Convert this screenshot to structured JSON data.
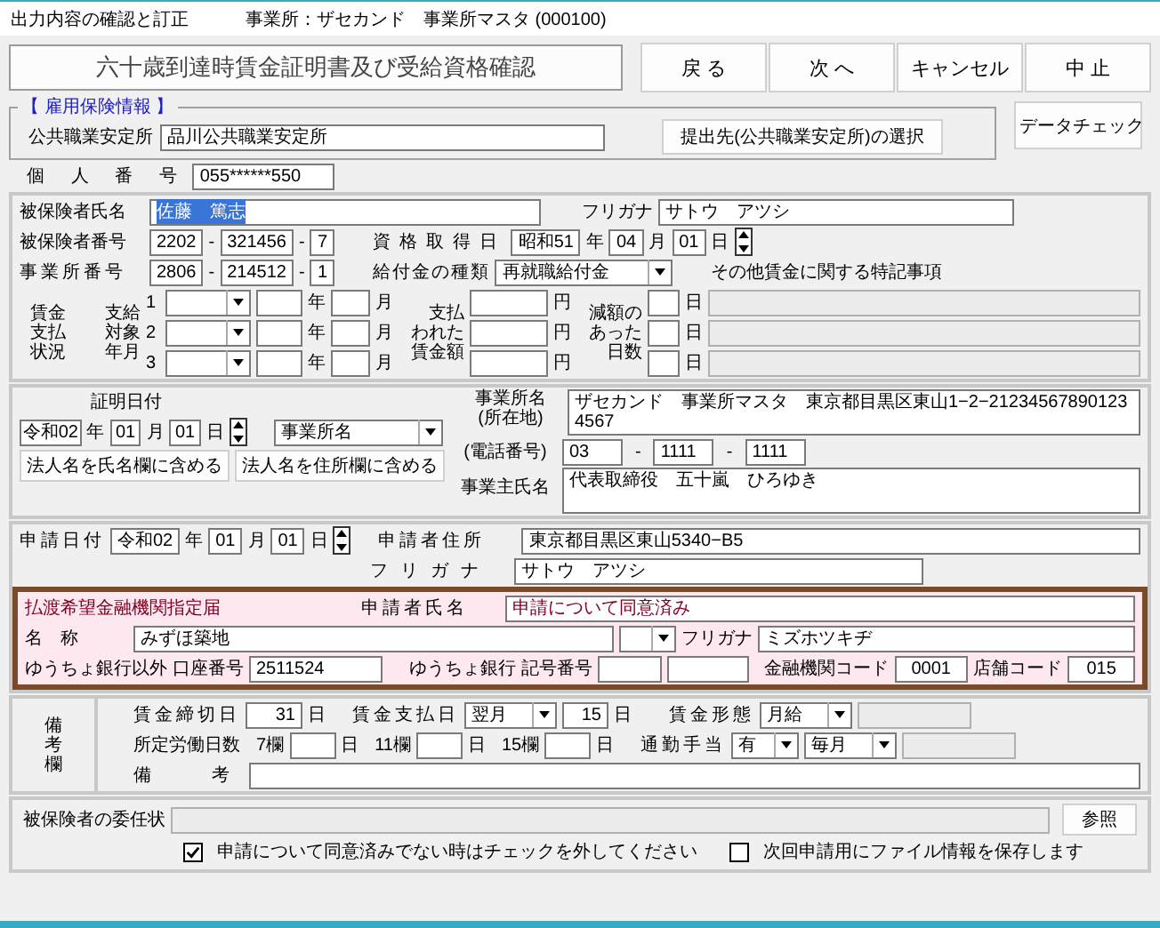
{
  "header": {
    "title": "出力内容の確認と訂正",
    "office": "事業所：ザセカンド　事業所マスタ (000100)"
  },
  "form_title": "六十歳到達時賃金証明書及び受給資格確認",
  "nav_buttons": [
    "戻 る",
    "次 へ",
    "キャンセル",
    "中 止"
  ],
  "insurance": {
    "legend": "【 雇用保険情報 】",
    "office_label": "公共職業安定所",
    "office_value": "品川公共職業安定所",
    "select_button": "提出先(公共職業安定所)の選択"
  },
  "data_check_button": "データチェック",
  "personal_number": {
    "label": "個 人 番 号",
    "value": "055******550"
  },
  "insured": {
    "name_label": "被保険者氏名",
    "name_value": "佐藤　篤志",
    "name_selected": true,
    "kana_label": "フリガナ",
    "kana_value": "サトウ　アツシ",
    "number_label": "被保険者番号",
    "number": [
      {
        "kind": "field",
        "text": "2202"
      },
      {
        "kind": "sep",
        "text": "-"
      },
      {
        "kind": "field",
        "text": "321456"
      },
      {
        "kind": "sep",
        "text": "-"
      },
      {
        "kind": "field",
        "text": "7"
      }
    ],
    "acq_label": "資格取得日",
    "acq_date": [
      {
        "kind": "field",
        "text": "昭和51"
      },
      {
        "kind": "sep",
        "text": "年"
      },
      {
        "kind": "field",
        "text": "04"
      },
      {
        "kind": "sep",
        "text": "月"
      },
      {
        "kind": "field",
        "text": "01"
      },
      {
        "kind": "sep",
        "text": "日"
      }
    ],
    "office_no_label": "事業所番号",
    "office_no": [
      {
        "kind": "field",
        "text": "2806"
      },
      {
        "kind": "sep",
        "text": "-"
      },
      {
        "kind": "field",
        "text": "214512"
      },
      {
        "kind": "sep",
        "text": "-"
      },
      {
        "kind": "field",
        "text": "1"
      }
    ],
    "benefit_label": "給付金の種類",
    "benefit_value": "再就職給付金",
    "remarks_label": "その他賃金に関する特記事項"
  },
  "wage": {
    "status_label": [
      "賃金",
      "支払",
      "状況"
    ],
    "period_label": [
      "支給",
      "対象",
      "年月"
    ],
    "paid_label": [
      "支払",
      "われた",
      "賃金額"
    ],
    "reduced_label": [
      "減額の",
      "あった",
      "日数"
    ],
    "rows": [
      {
        "no": "1",
        "year_unit": "年",
        "month_unit": "月",
        "yen_unit": "円",
        "day_unit": "日"
      },
      {
        "no": "2",
        "year_unit": "年",
        "month_unit": "月",
        "yen_unit": "円",
        "day_unit": "日"
      },
      {
        "no": "3",
        "year_unit": "年",
        "month_unit": "月",
        "yen_unit": "円",
        "day_unit": "日"
      }
    ]
  },
  "cert": {
    "date_label": "証明日付",
    "date": [
      {
        "kind": "field",
        "text": "令和02"
      },
      {
        "kind": "sep",
        "text": "年"
      },
      {
        "kind": "field",
        "text": "01"
      },
      {
        "kind": "sep",
        "text": "月"
      },
      {
        "kind": "field",
        "text": "01"
      },
      {
        "kind": "sep",
        "text": "日"
      }
    ],
    "office_select": "事業所名",
    "buttons": [
      "法人名を氏名欄に含める",
      "法人名を住所欄に含める"
    ],
    "office_label": "事業所名\n(所在地)",
    "office_value": "ザセカンド　事業所マスタ　東京都目黒区東山1−2−212345678901234567",
    "phone_label": "(電話番号)",
    "phone": [
      {
        "kind": "field",
        "text": "03"
      },
      {
        "kind": "sep",
        "text": "-"
      },
      {
        "kind": "field",
        "text": "1111"
      },
      {
        "kind": "sep",
        "text": "-"
      },
      {
        "kind": "field",
        "text": "1111"
      }
    ],
    "owner_label": "事業主氏名",
    "owner_value": "代表取締役　五十嵐　ひろゆき"
  },
  "application": {
    "date_label": "申請日付",
    "date": [
      {
        "kind": "field",
        "text": "令和02"
      },
      {
        "kind": "sep",
        "text": "年"
      },
      {
        "kind": "field",
        "text": "01"
      },
      {
        "kind": "sep",
        "text": "月"
      },
      {
        "kind": "field",
        "text": "01"
      },
      {
        "kind": "sep",
        "text": "日"
      }
    ],
    "address_label": "申請者住所",
    "address_value": "東京都目黒区東山5340−B5",
    "kana_label": "フリガナ",
    "kana_value": "サトウ　アツシ",
    "name_label": "申請者氏名",
    "name_value": "申請について同意済み"
  },
  "bank": {
    "highlighted": true,
    "title": "払渡希望金融機関指定届",
    "name_label": "名　称",
    "name_value": "みずほ築地",
    "kana_label": "フリガナ",
    "kana_value": "ミズホツキヂ",
    "non_yucho_label": "ゆうちょ銀行以外",
    "account_label": "口座番号",
    "account_value": "2511524",
    "yucho_label": "ゆうちょ銀行",
    "symbol_label": "記号番号",
    "bank_code_label": "金融機関コード",
    "bank_code": "0001",
    "branch_code_label": "店舗コード",
    "branch_code": "015"
  },
  "remarks": {
    "label": "備考欄",
    "closing_label": "賃金締切日",
    "closing_day": "31",
    "closing_unit": "日",
    "pay_label": "賃金支払日",
    "pay_month": "翌月",
    "pay_day": "15",
    "pay_day_unit": "日",
    "form_label": "賃金形態",
    "form_value": "月給",
    "workdays_label": "所定労働日数",
    "workdays": [
      {
        "label": "7欄",
        "unit": "日"
      },
      {
        "label": "11欄",
        "unit": "日"
      },
      {
        "label": "15欄",
        "unit": "日"
      }
    ],
    "commute_label": "通勤手当",
    "commute_value": "有",
    "commute_freq": "毎月",
    "note_label": "備　考"
  },
  "footer": {
    "proxy_label": "被保険者の委任状",
    "browse_button": "参照",
    "checks": [
      {
        "label": "申請について同意済みでない時はチェックを外してください",
        "checked": true
      },
      {
        "label": "次回申請用にファイル情報を保存します",
        "checked": false
      }
    ]
  }
}
